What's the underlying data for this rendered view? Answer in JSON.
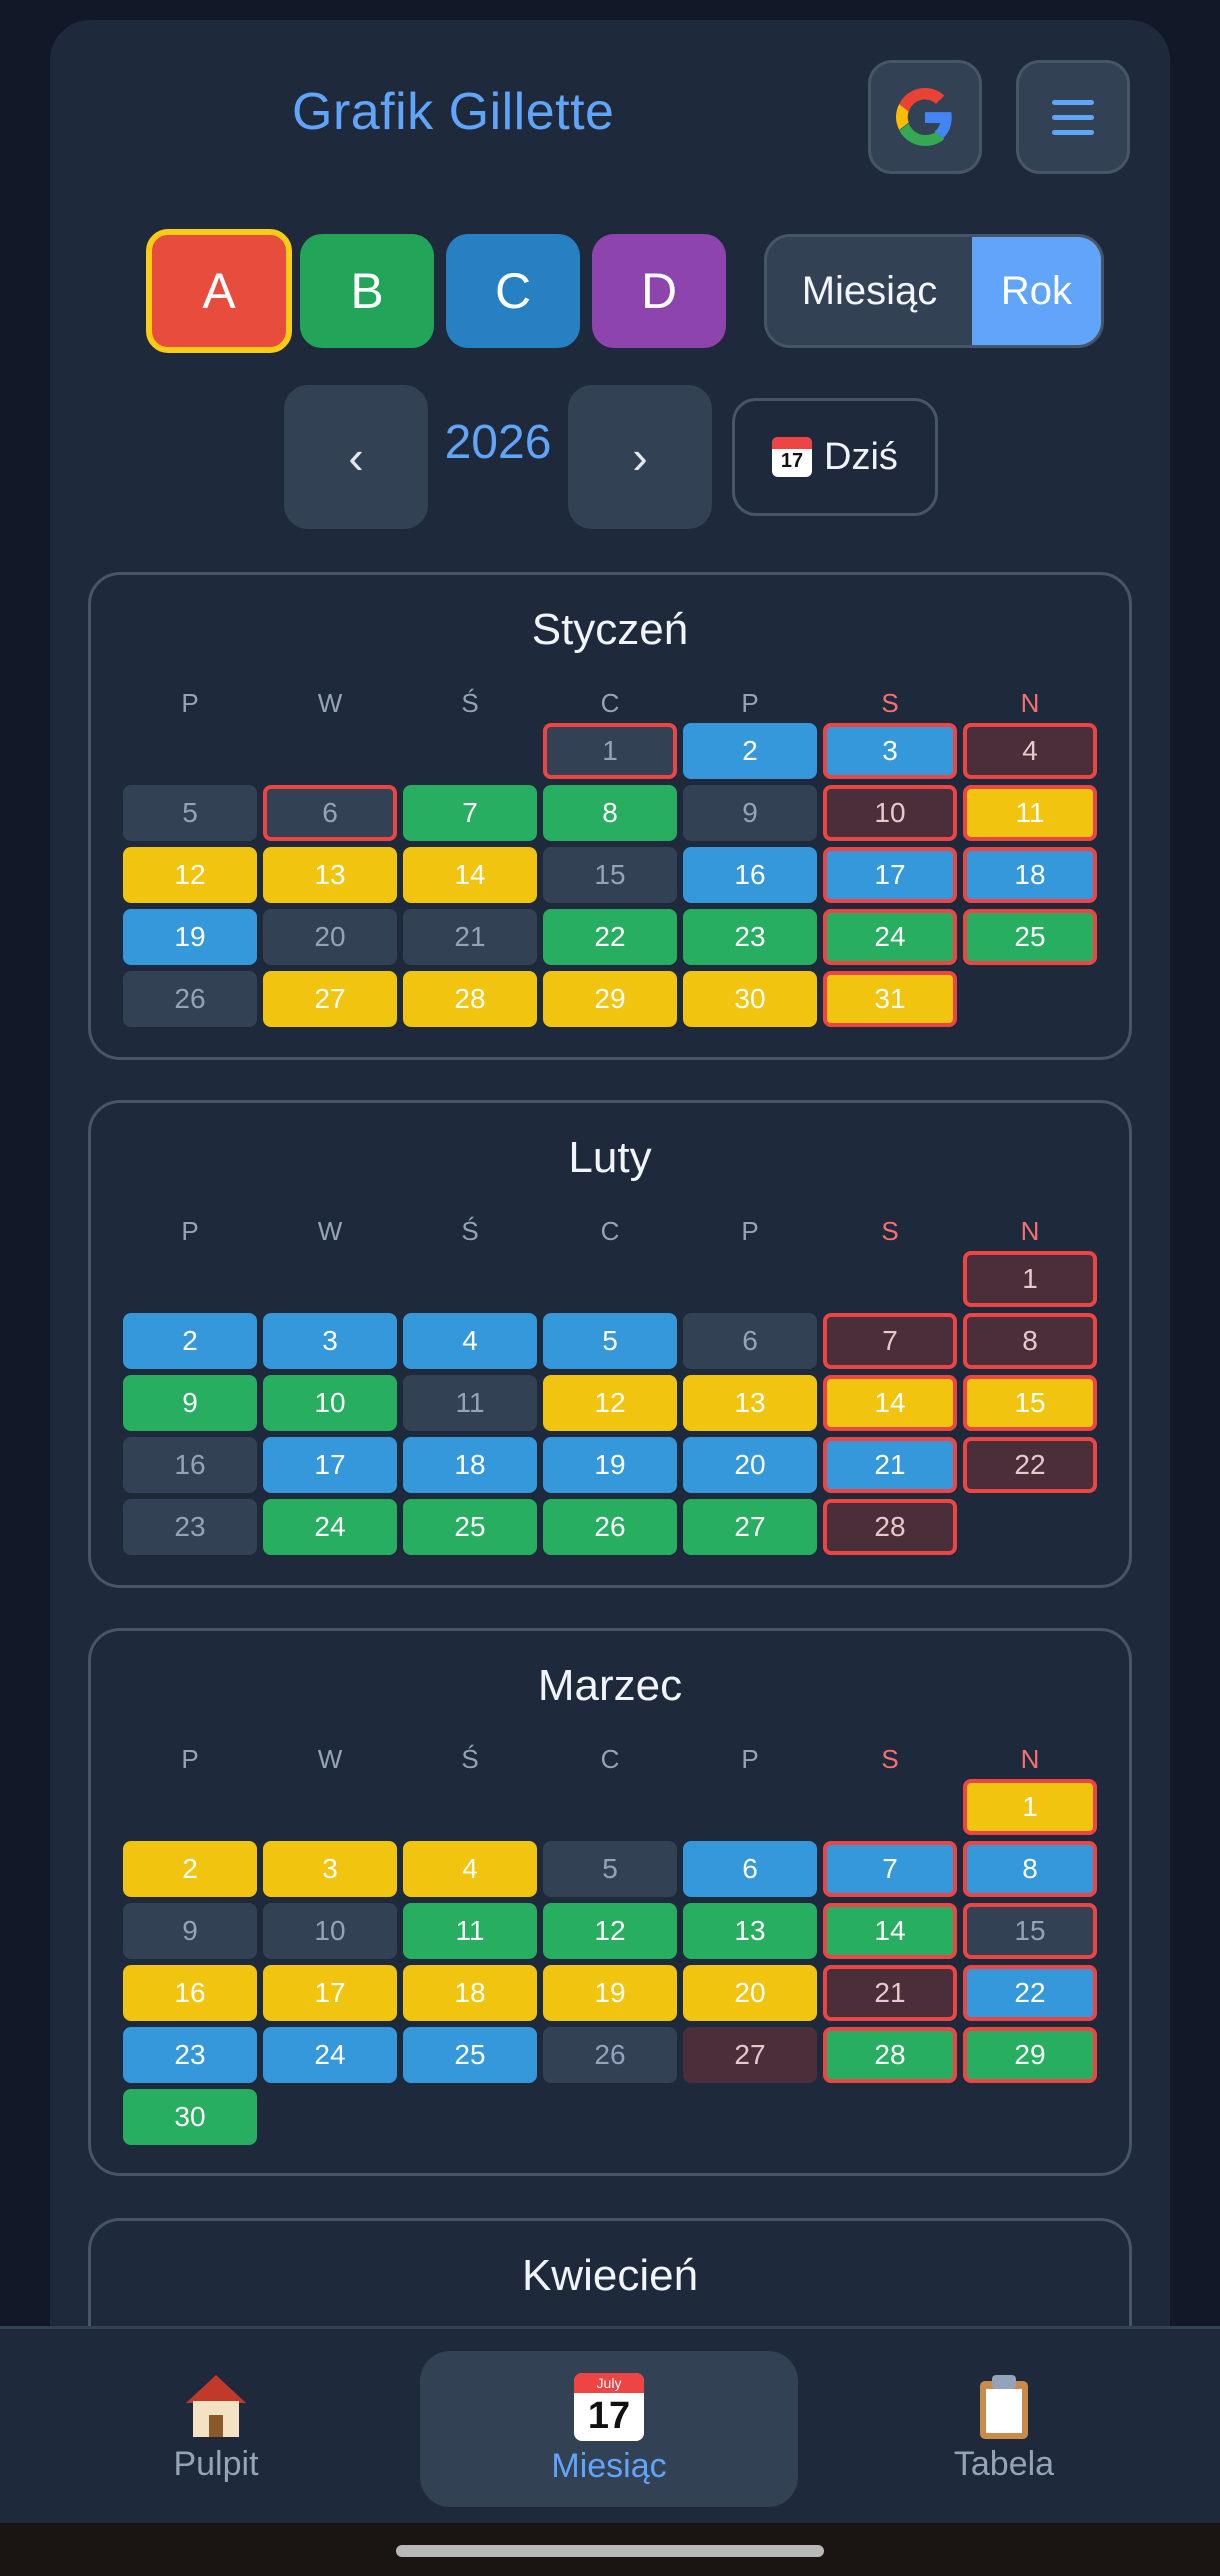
{
  "header": {
    "title": "Grafik Gillette"
  },
  "shifts": [
    {
      "label": "A",
      "color": "#e74c3c",
      "selected": true
    },
    {
      "label": "B",
      "color": "#22a559"
    },
    {
      "label": "C",
      "color": "#2680c2"
    },
    {
      "label": "D",
      "color": "#8e44ad"
    }
  ],
  "view_toggle": {
    "month_label": "Miesiąc",
    "year_label": "Rok",
    "active": "Rok"
  },
  "year_nav": {
    "prev_glyph": "‹",
    "year": "2026",
    "next_glyph": "›",
    "today_label": "Dziś"
  },
  "weekdays": [
    "P",
    "W",
    "Ś",
    "C",
    "P",
    "S",
    "N"
  ],
  "legend": {
    "Y": "#f1c40f",
    "G": "#27ae60",
    "B": "#3498db",
    "O": "#334155",
    "H": "#4a2f3b",
    "mark_border": "#ef4444"
  },
  "months": [
    {
      "name": "Styczeń",
      "offset": 3,
      "types": "OBBHOOGGOHYYYYOBBBBOOGGGGOYYYYY",
      "marked": [
        1,
        3,
        4,
        6,
        10,
        11,
        17,
        18,
        24,
        25,
        31
      ]
    },
    {
      "name": "Luty",
      "offset": 6,
      "types": "HBBBBOHHGGOYYYYOBBBBBHOGGGGH",
      "marked": [
        1,
        7,
        8,
        14,
        15,
        21,
        22,
        28
      ]
    },
    {
      "name": "Marzec",
      "offset": 6,
      "types": "YYYYOBBBOOGGGGOYYYYYHBBBBOHGGG",
      "marked": [
        1,
        7,
        8,
        14,
        15,
        21,
        22,
        28,
        29
      ]
    },
    {
      "name": "Kwiecień"
    }
  ],
  "bottom_nav": {
    "tabs": [
      {
        "label": "Pulpit",
        "icon": "house-icon"
      },
      {
        "label": "Miesiąc",
        "icon": "calendar-icon",
        "active": true
      },
      {
        "label": "Tabela",
        "icon": "clipboard-icon"
      }
    ],
    "calendar_icon_month": "July",
    "calendar_icon_day": "17"
  }
}
